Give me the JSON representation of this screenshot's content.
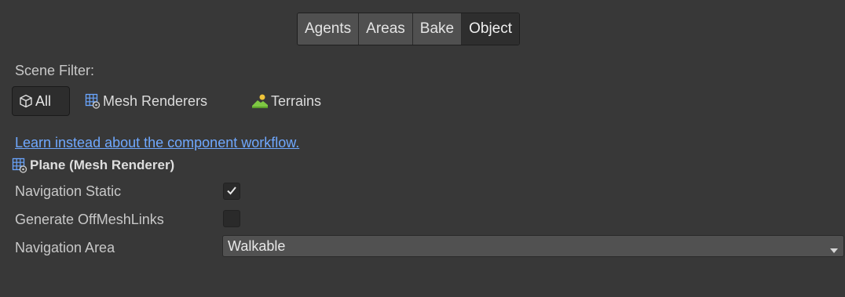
{
  "tabs": [
    {
      "label": "Agents",
      "active": false
    },
    {
      "label": "Areas",
      "active": false
    },
    {
      "label": "Bake",
      "active": false
    },
    {
      "label": "Object",
      "active": true
    }
  ],
  "scene_filter": {
    "label": "Scene Filter:",
    "options": [
      {
        "label": "All",
        "icon": "cube-icon",
        "selected": true
      },
      {
        "label": "Mesh Renderers",
        "icon": "mesh-renderer-icon",
        "selected": false
      },
      {
        "label": "Terrains",
        "icon": "terrain-icon",
        "selected": false
      }
    ]
  },
  "workflow_link": "Learn instead about the component workflow.",
  "object": {
    "title": "Plane (Mesh Renderer)",
    "icon": "mesh-renderer-icon"
  },
  "properties": {
    "navigation_static": {
      "label": "Navigation Static",
      "checked": true
    },
    "generate_offmeshlinks": {
      "label": "Generate OffMeshLinks",
      "checked": false
    },
    "navigation_area": {
      "label": "Navigation Area",
      "value": "Walkable"
    }
  },
  "colors": {
    "background": "#383838",
    "link": "#6fa8ff",
    "terrain_green": "#7ec843",
    "terrain_yellow": "#f0c43a"
  }
}
